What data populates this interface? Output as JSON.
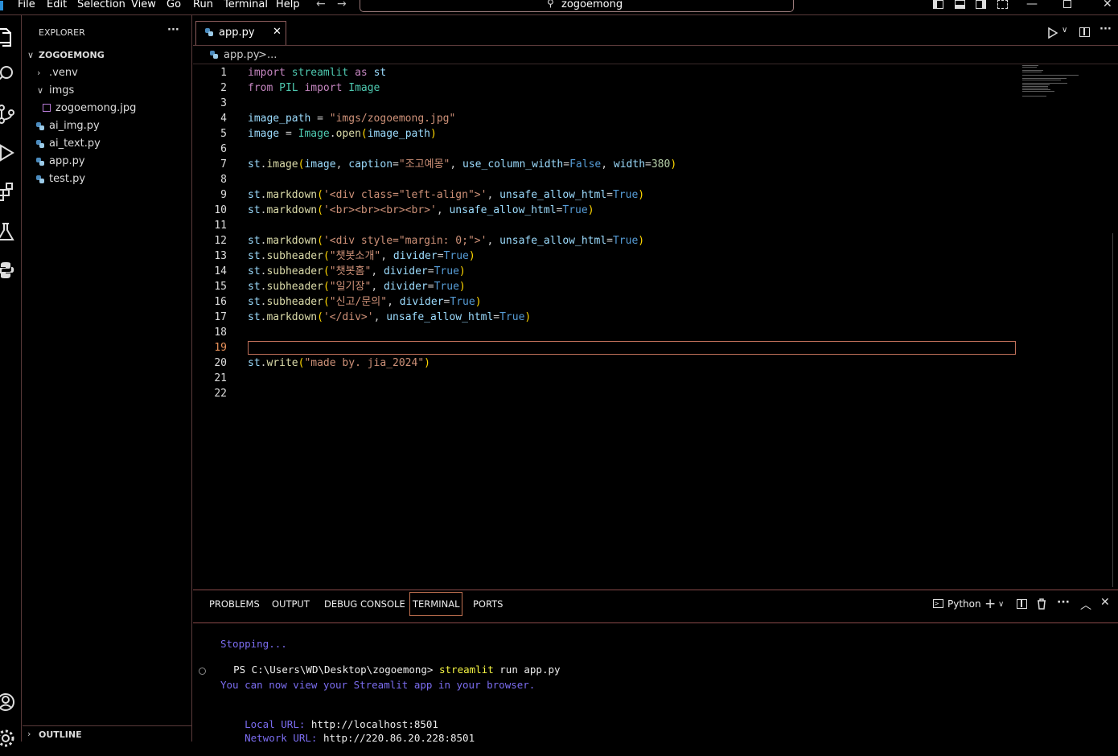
{
  "menu": [
    "File",
    "Edit",
    "Selection",
    "View",
    "Go",
    "Run",
    "Terminal",
    "Help"
  ],
  "search": {
    "text": "zogoemong"
  },
  "sidebar": {
    "header": "EXPLORER",
    "more": "···",
    "root": "ZOGOEMONG",
    "items": [
      {
        "label": ".venv",
        "type": "folder-collapsed"
      },
      {
        "label": "imgs",
        "type": "folder-expanded"
      },
      {
        "label": "zogoemong.jpg",
        "type": "image"
      },
      {
        "label": "ai_img.py",
        "type": "python"
      },
      {
        "label": "ai_text.py",
        "type": "python"
      },
      {
        "label": "app.py",
        "type": "python"
      },
      {
        "label": "test.py",
        "type": "python"
      }
    ],
    "outline": "OUTLINE"
  },
  "tab": {
    "label": "app.py",
    "close": "✕"
  },
  "breadcrumb": {
    "file": "app.py",
    "sep": ">",
    "rest": "..."
  },
  "editor": {
    "active_line": 19,
    "lines": [
      "import streamlit as st",
      "from PIL import Image",
      "",
      "image_path = \"imgs/zogoemong.jpg\"",
      "image = Image.open(image_path)",
      "",
      "st.image(image, caption=\"조고예몽\", use_column_width=False, width=380)",
      "",
      "st.markdown('<div class=\"left-align\">', unsafe_allow_html=True)",
      "st.markdown('<br><br><br><br>', unsafe_allow_html=True)",
      "",
      "st.markdown('<div style=\"margin: 0;\">', unsafe_allow_html=True)",
      "st.subheader(\"챗봇소개\", divider=True)",
      "st.subheader(\"챗봇홈\", divider=True)",
      "st.subheader(\"일기장\", divider=True)",
      "st.subheader(\"신고/문의\", divider=True)",
      "st.markdown('</div>', unsafe_allow_html=True)",
      "",
      "",
      "st.write(\"made by. jia_2024\")",
      "",
      ""
    ]
  },
  "panel": {
    "tabs": [
      "PROBLEMS",
      "OUTPUT",
      "DEBUG CONSOLE",
      "TERMINAL",
      "PORTS"
    ],
    "active_tab": "TERMINAL",
    "shell": "Python",
    "terminal": {
      "stopping": "Stopping...",
      "prompt": "PS C:\\Users\\WD\\Desktop\\zogoemong>",
      "cmd_name": "streamlit",
      "cmd_args": "run app.py",
      "view_msg": "You can now view your Streamlit app in your browser.",
      "local_label": "Local URL:",
      "local_url": "http://localhost:8501",
      "network_label": "Network URL:",
      "network_url": "http://220.86.20.228:8501"
    }
  }
}
